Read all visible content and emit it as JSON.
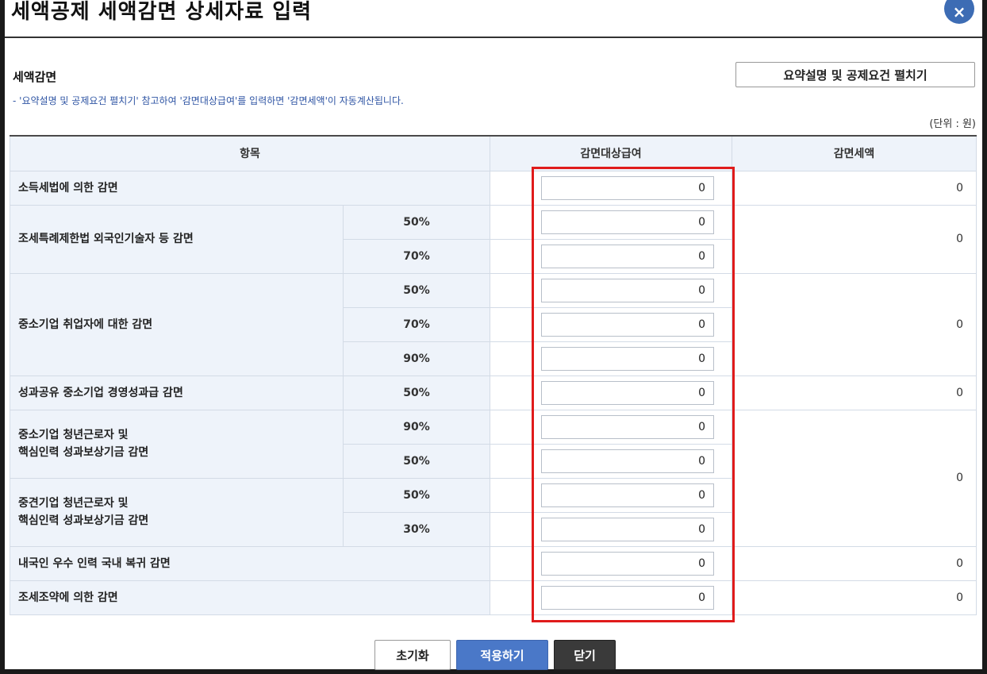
{
  "dialog": {
    "title": "세액공제 세액감면 상세자료 입력",
    "close_label": "×"
  },
  "section": {
    "title": "세액감면",
    "summary_button": "요약설명 및 공제요건 펼치기",
    "note": "- '요약설명 및 공제요건 펼치기' 참고하여 '감면대상급여'를 입력하면 '감면세액'이 자동계산됩니다.",
    "unit": "(단위 : 원)"
  },
  "table": {
    "headers": {
      "item": "항목",
      "target_pay": "감면대상급여",
      "tax_reduction": "감면세액"
    },
    "groups": [
      {
        "label": "소득세법에 의한 감면",
        "rates": [
          ""
        ],
        "amounts": [
          "0"
        ],
        "tax": "0"
      },
      {
        "label": "조세특례제한법 외국인기술자 등 감면",
        "rates": [
          "50%",
          "70%"
        ],
        "amounts": [
          "0",
          "0"
        ],
        "tax": "0"
      },
      {
        "label": "중소기업 취업자에 대한 감면",
        "rates": [
          "50%",
          "70%",
          "90%"
        ],
        "amounts": [
          "0",
          "0",
          "0"
        ],
        "tax": "0"
      },
      {
        "label": "성과공유 중소기업 경영성과급 감면",
        "rates": [
          "50%"
        ],
        "amounts": [
          "0"
        ],
        "tax": "0"
      },
      {
        "label": "중소기업 청년근로자 및\n핵심인력 성과보상기금 감면",
        "rates": [
          "90%",
          "50%"
        ],
        "amounts": [
          "0",
          "0"
        ],
        "tax": "0"
      },
      {
        "label": "중견기업 청년근로자 및\n핵심인력 성과보상기금 감면",
        "rates": [
          "50%",
          "30%"
        ],
        "amounts": [
          "0",
          "0"
        ],
        "tax": ""
      },
      {
        "label": "내국인 우수 인력 국내 복귀 감면",
        "rates": [
          ""
        ],
        "amounts": [
          "0"
        ],
        "tax": "0"
      },
      {
        "label": "조세조약에 의한 감면",
        "rates": [
          ""
        ],
        "amounts": [
          "0"
        ],
        "tax": "0"
      }
    ]
  },
  "buttons": {
    "reset": "초기화",
    "apply": "적용하기",
    "close": "닫기"
  },
  "colors": {
    "header_bg": "#eef3fa",
    "highlight_border": "#e01b1b",
    "apply_bg": "#4a78c8",
    "close_bg": "#3a3a3a",
    "note_text": "#2f55a4"
  }
}
